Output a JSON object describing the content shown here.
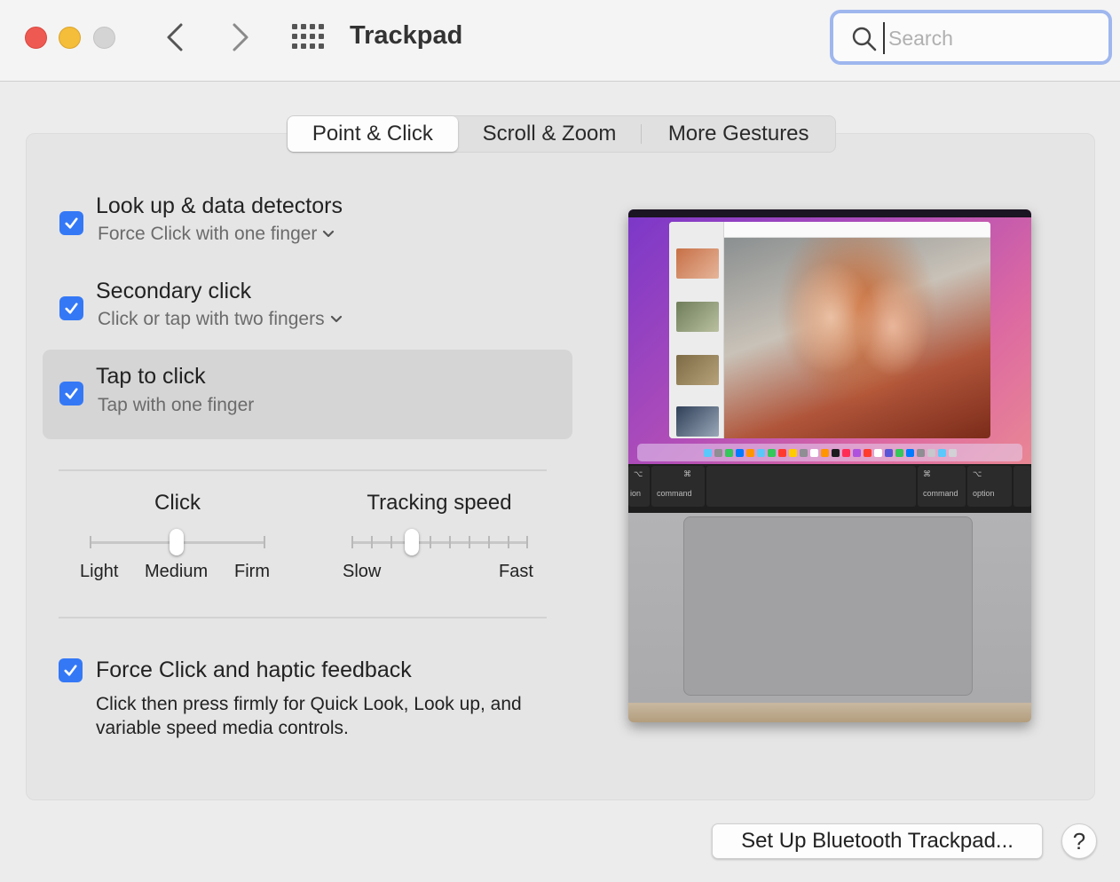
{
  "window": {
    "title": "Trackpad",
    "search_placeholder": "Search"
  },
  "tabs": [
    {
      "label": "Point & Click",
      "active": true
    },
    {
      "label": "Scroll & Zoom",
      "active": false
    },
    {
      "label": "More Gestures",
      "active": false
    }
  ],
  "options": {
    "lookup": {
      "title": "Look up & data detectors",
      "subtitle": "Force Click with one finger",
      "checked": true
    },
    "secondary": {
      "title": "Secondary click",
      "subtitle": "Click or tap with two fingers",
      "checked": true
    },
    "tap": {
      "title": "Tap to click",
      "subtitle": "Tap with one finger",
      "checked": true
    },
    "force": {
      "title": "Force Click and haptic feedback",
      "description": "Click then press firmly for Quick Look, Look up, and variable speed media controls.",
      "checked": true
    }
  },
  "click_slider": {
    "title": "Click",
    "labels": [
      "Light",
      "Medium",
      "Firm"
    ],
    "value_index": 1,
    "steps": 3
  },
  "tracking_slider": {
    "title": "Tracking speed",
    "min_label": "Slow",
    "max_label": "Fast",
    "value_index": 3,
    "steps": 10
  },
  "buttons": {
    "bluetooth": "Set Up Bluetooth Trackpad...",
    "help": "?"
  },
  "preview": {
    "keys": [
      "ion",
      "command",
      "command",
      "option"
    ]
  },
  "colors": {
    "accent": "#3478f6",
    "close": "#ee5a52",
    "minimize": "#f4bd3a",
    "zoom_disabled": "#d4d4d4",
    "search_focus": "#9fb7ee"
  }
}
